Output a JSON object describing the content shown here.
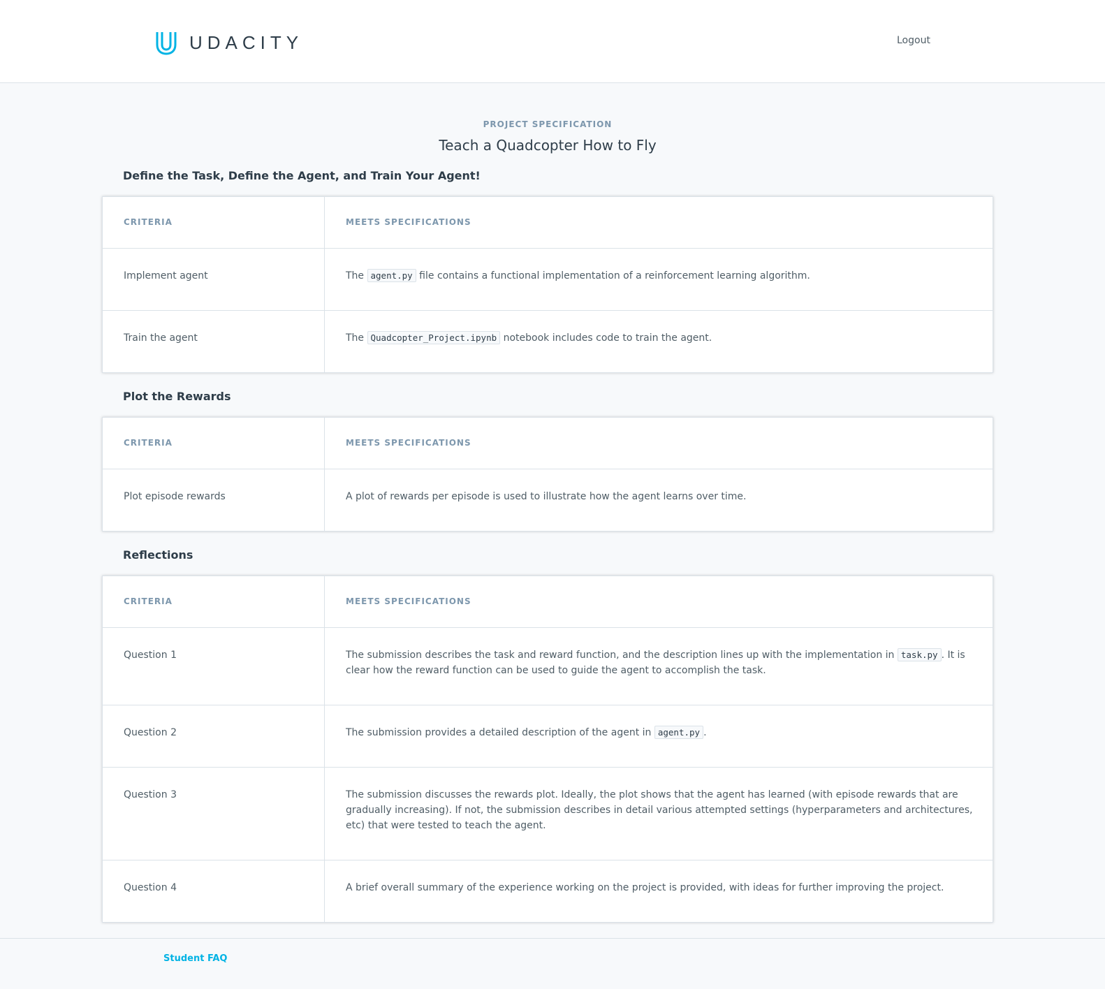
{
  "header": {
    "logo_text": "UDACITY",
    "logout_label": "Logout"
  },
  "spec": {
    "label": "PROJECT SPECIFICATION",
    "title": "Teach a Quadcopter How to Fly"
  },
  "table_headers": {
    "criteria": "CRITERIA",
    "meets": "MEETS SPECIFICATIONS"
  },
  "sections": [
    {
      "title": "Define the Task, Define the Agent, and Train Your Agent!",
      "rows": [
        {
          "criteria": "Implement agent",
          "pre": "The ",
          "code": "agent.py",
          "post": " file contains a functional implementation of a reinforcement learning algorithm."
        },
        {
          "criteria": "Train the agent",
          "pre": "The ",
          "code": "Quadcopter_Project.ipynb",
          "post": " notebook includes code to train the agent."
        }
      ]
    },
    {
      "title": "Plot the Rewards",
      "rows": [
        {
          "criteria": "Plot episode rewards",
          "pre": "A plot of rewards per episode is used to illustrate how the agent learns over time."
        }
      ]
    },
    {
      "title": "Reflections",
      "rows": [
        {
          "criteria": "Question 1",
          "pre": "The submission describes the task and reward function, and the description lines up with the implementation in ",
          "code": "task.py",
          "post": ". It is clear how the reward function can be used to guide the agent to accomplish the task."
        },
        {
          "criteria": "Question 2",
          "pre": "The submission provides a detailed description of the agent in ",
          "code": "agent.py",
          "post": "."
        },
        {
          "criteria": "Question 3",
          "pre": "The submission discusses the rewards plot. Ideally, the plot shows that the agent has learned (with episode rewards that are gradually increasing). If not, the submission describes in detail various attempted settings (hyperparameters and architectures, etc) that were tested to teach the agent."
        },
        {
          "criteria": "Question 4",
          "pre": "A brief overall summary of the experience working on the project is provided, with ideas for further improving the project."
        }
      ]
    }
  ],
  "footer": {
    "faq_label": "Student FAQ"
  },
  "colors": {
    "accent": "#02b3e4",
    "text": "#2e3d49",
    "muted": "#7d97ad"
  }
}
